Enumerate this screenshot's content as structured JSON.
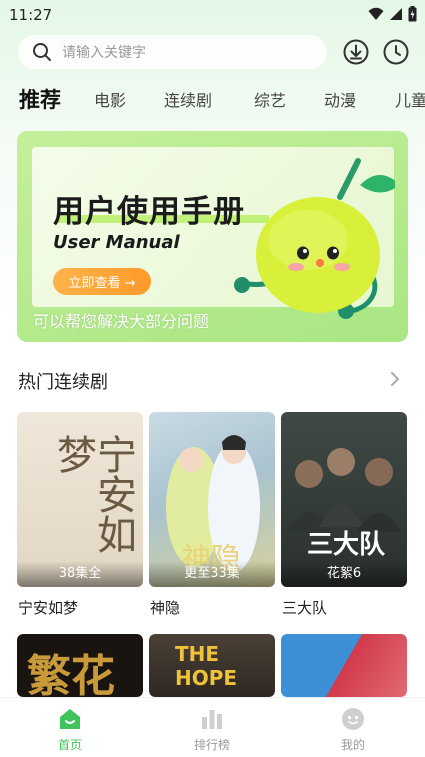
{
  "status_bar": {
    "time": "11:27"
  },
  "search": {
    "placeholder": "请输入关键字"
  },
  "tabs": [
    {
      "label": "推荐",
      "active": true
    },
    {
      "label": "电影"
    },
    {
      "label": "连续剧"
    },
    {
      "label": "综艺"
    },
    {
      "label": "动漫"
    },
    {
      "label": "儿童"
    }
  ],
  "banner": {
    "title": "用户使用手册",
    "subtitle": "User Manual",
    "button_label": "立即查看 →",
    "caption": "可以帮您解决大部分问题"
  },
  "section": {
    "title": "热门连续剧"
  },
  "cards": [
    {
      "title": "宁安如梦",
      "badge": "38集全",
      "poster_text": "宁安如梦"
    },
    {
      "title": "神隐",
      "badge": "更至33集",
      "poster_text": "神隐"
    },
    {
      "title": "三大队",
      "badge": "花絮6",
      "poster_text": "三大队"
    }
  ],
  "cards_row2": [
    {
      "poster_text": "繁花"
    },
    {
      "poster_text": "THE HOPE"
    },
    {
      "poster_text": ""
    }
  ],
  "bottom_nav": [
    {
      "label": "首页",
      "icon": "home-icon",
      "active": true
    },
    {
      "label": "排行榜",
      "icon": "bar-chart-icon"
    },
    {
      "label": "我的",
      "icon": "user-face-icon"
    }
  ],
  "colors": {
    "accent": "#3fc35a",
    "banner_button": "#ff9a2a",
    "banner_bg": "#a9e683"
  }
}
